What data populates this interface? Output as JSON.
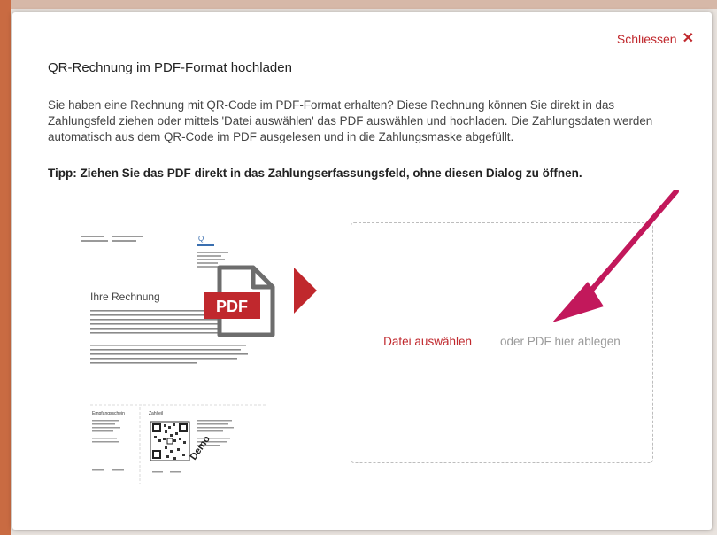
{
  "dialog": {
    "close_label": "Schliessen",
    "close_icon": "close-icon",
    "title": "QR-Rechnung im PDF-Format hochladen",
    "description": "Sie haben eine Rechnung mit QR-Code im PDF-Format erhalten? Diese Rechnung können Sie direkt in das Zahlungsfeld ziehen oder mittels 'Datei auswählen' das PDF auswählen und hochladen. Die Zahlungsdaten werden automatisch aus dem QR-Code im PDF ausgelesen und in die Zahlungsmaske abgefüllt.",
    "tip": "Tipp: Ziehen Sie das PDF direkt in das Zahlungserfassungsfeld, ohne diesen Dialog zu öffnen."
  },
  "preview": {
    "invoice_heading": "Ihre Rechnung",
    "pdf_badge": "PDF",
    "demo_watermark": "Demo",
    "receipt_title": "Empfangsschein",
    "payment_title": "Zahlteil"
  },
  "dropzone": {
    "choose_file_label": "Datei auswählen",
    "drop_hint": "oder PDF hier ablegen"
  },
  "colors": {
    "accent_red": "#c0282d",
    "arrow_magenta": "#c2185b",
    "pdf_icon_gray": "#6d6d6d"
  }
}
